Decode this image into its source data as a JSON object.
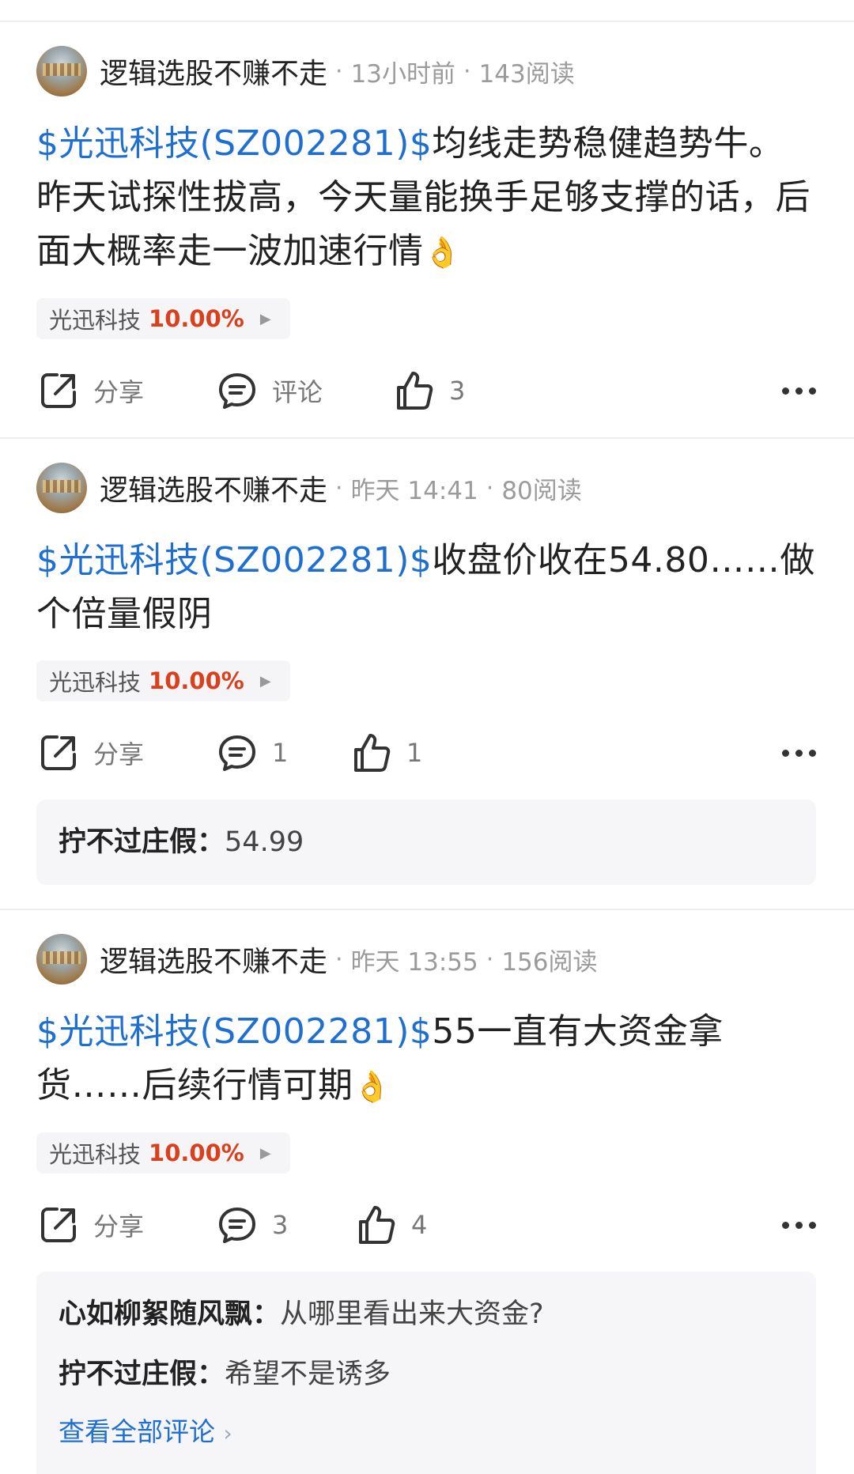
{
  "posts": [
    {
      "author": "逻辑选股不赚不走",
      "time": "13小时前",
      "reads": "143阅读",
      "stock_tag": "$光迅科技(SZ002281)$",
      "text": "均线走势稳健趋势牛。昨天试探性拔高，今天量能换手足够支撑的话，后面大概率走一波加速行情",
      "emoji": "👌",
      "chip_name": "光迅科技",
      "chip_change": "10.00%",
      "share_label": "分享",
      "comment_label": "评论",
      "like_count": "3"
    },
    {
      "author": "逻辑选股不赚不走",
      "time": "昨天 14:41",
      "reads": "80阅读",
      "stock_tag": "$光迅科技(SZ002281)$",
      "text": "收盘价收在54.80……做个倍量假阴",
      "chip_name": "光迅科技",
      "chip_change": "10.00%",
      "share_label": "分享",
      "comment_count": "1",
      "like_count": "1",
      "comments": [
        {
          "name": "拧不过庄假",
          "text": "54.99"
        }
      ]
    },
    {
      "author": "逻辑选股不赚不走",
      "time": "昨天 13:55",
      "reads": "156阅读",
      "stock_tag": "$光迅科技(SZ002281)$",
      "text": "55一直有大资金拿货……后续行情可期",
      "emoji": "👌",
      "chip_name": "光迅科技",
      "chip_change": "10.00%",
      "share_label": "分享",
      "comment_count": "3",
      "like_count": "4",
      "comments": [
        {
          "name": "心如柳絮随风飘",
          "text": "从哪里看出来大资金?"
        },
        {
          "name": "拧不过庄假",
          "text": "希望不是诱多"
        }
      ],
      "see_all": "查看全部评论"
    }
  ]
}
